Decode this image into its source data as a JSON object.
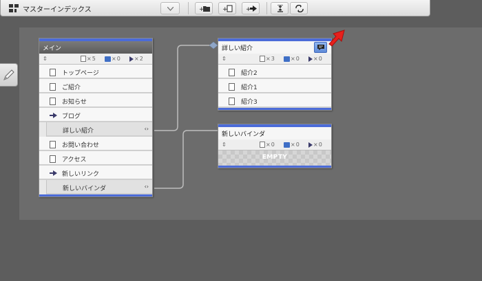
{
  "toolbar": {
    "title": "マスターインデックス",
    "buttons": [
      "add-folder-icon",
      "add-page-icon",
      "add-link-icon",
      "align-icon",
      "swap-icon"
    ]
  },
  "nodes": {
    "main": {
      "title": "メイン",
      "stats": {
        "pages": "5",
        "links": "0",
        "arrows": "2"
      },
      "rows": [
        {
          "label": "トップページ",
          "type": "page"
        },
        {
          "label": "ご紹介",
          "type": "page"
        },
        {
          "label": "お知らせ",
          "type": "page"
        },
        {
          "label": "ブログ",
          "type": "link"
        },
        {
          "label": "詳しい紹介",
          "type": "folder"
        },
        {
          "label": "お問い合わせ",
          "type": "page"
        },
        {
          "label": "アクセス",
          "type": "page"
        },
        {
          "label": "新しいリンク",
          "type": "link"
        },
        {
          "label": "新しいバインダ",
          "type": "folder"
        }
      ]
    },
    "detail": {
      "title": "詳しい紹介",
      "stats": {
        "pages": "3",
        "links": "0",
        "arrows": "0"
      },
      "rows": [
        {
          "label": "紹介2"
        },
        {
          "label": "紹介1"
        },
        {
          "label": "紹介3"
        }
      ]
    },
    "binder": {
      "title": "新しいバインダ",
      "stats": {
        "pages": "0",
        "links": "0",
        "arrows": "0"
      },
      "empty_label": "EMPTY"
    }
  },
  "colors": {
    "accent": "#4b6bd8",
    "canvas": "#6c6c6c",
    "background": "#5d5d5d",
    "highlight_arrow": "#e8201c"
  }
}
